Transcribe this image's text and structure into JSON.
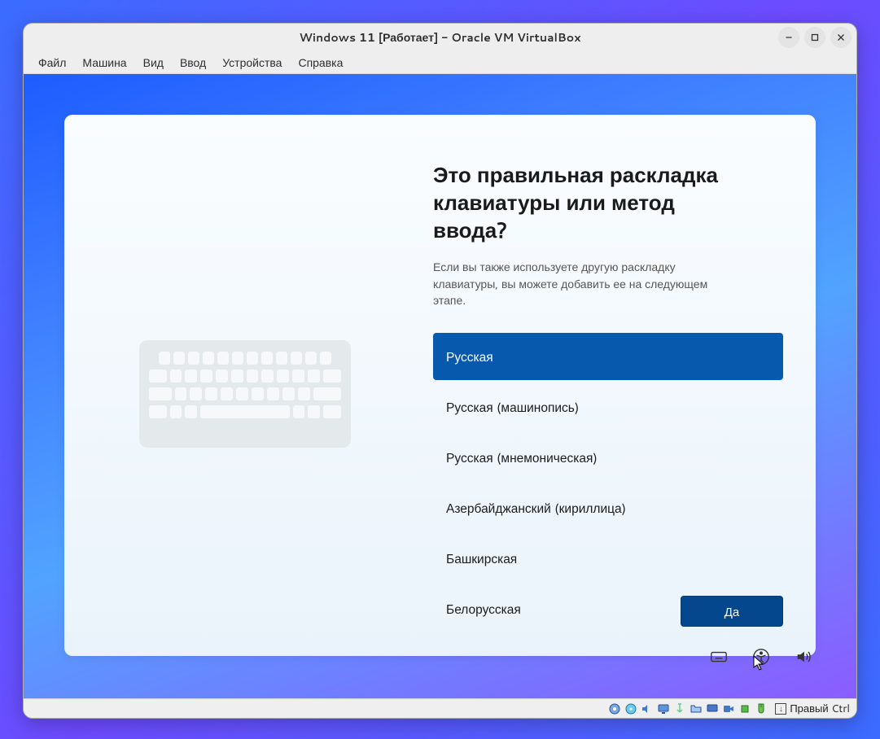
{
  "vbox": {
    "title": "Windows 11 [Работает] - Oracle VM VirtualBox",
    "menu": [
      "Файл",
      "Машина",
      "Вид",
      "Ввод",
      "Устройства",
      "Справка"
    ],
    "hostkey_label": "Правый Ctrl"
  },
  "oobe": {
    "heading": "Это правильная раскладка клавиатуры или метод ввода?",
    "subtitle": "Если вы также используете другую раскладку клавиатуры, вы можете добавить ее на следующем этапе.",
    "layouts": [
      {
        "label": "Русская",
        "selected": true
      },
      {
        "label": "Русская (машинопись)",
        "selected": false
      },
      {
        "label": "Русская (мнемоническая)",
        "selected": false
      },
      {
        "label": "Азербайджанский (кириллица)",
        "selected": false
      },
      {
        "label": "Башкирская",
        "selected": false
      },
      {
        "label": "Белорусская",
        "selected": false
      }
    ],
    "yes_label": "Да"
  },
  "colors": {
    "accent": "#0759ad",
    "button": "#04478c"
  }
}
